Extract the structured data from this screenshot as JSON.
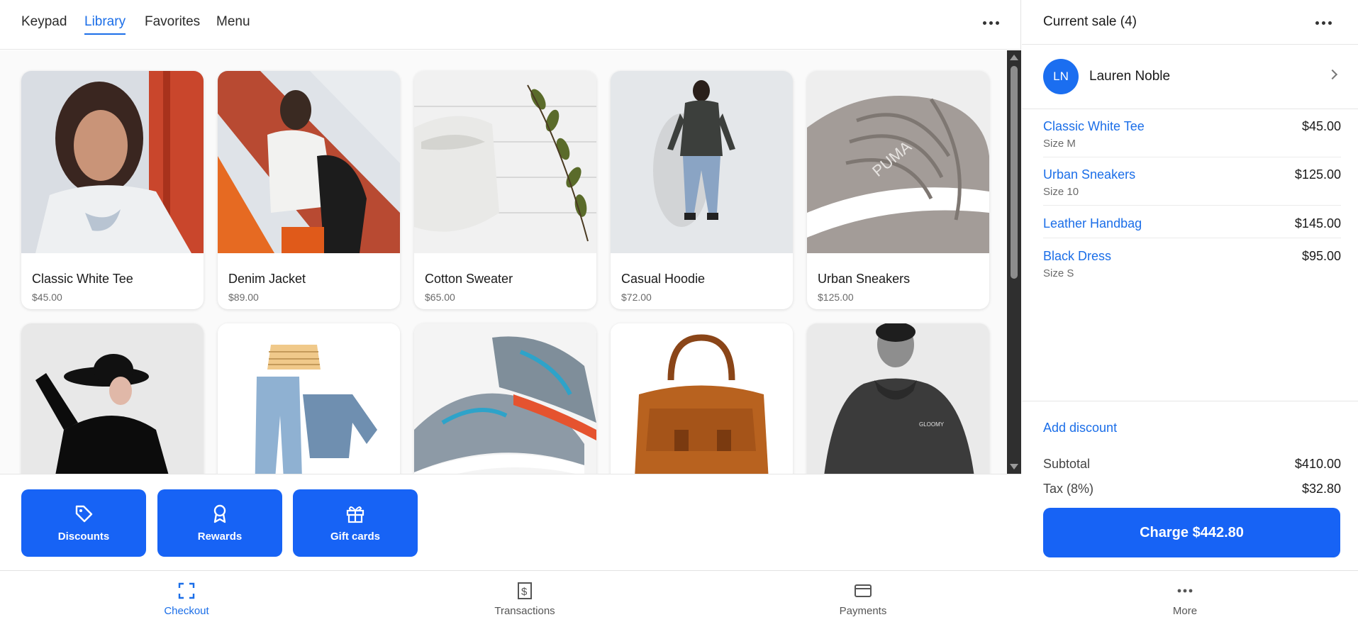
{
  "tabs": {
    "keypad": "Keypad",
    "library": "Library",
    "favorites": "Favorites",
    "menu": "Menu",
    "active": "Library"
  },
  "products": [
    {
      "name": "Classic White Tee",
      "price": "$45.00"
    },
    {
      "name": "Denim Jacket",
      "price": "$89.00"
    },
    {
      "name": "Cotton Sweater",
      "price": "$65.00"
    },
    {
      "name": "Casual Hoodie",
      "price": "$72.00"
    },
    {
      "name": "Urban Sneakers",
      "price": "$125.00"
    }
  ],
  "actions": {
    "discounts": "Discounts",
    "rewards": "Rewards",
    "gift_cards": "Gift cards"
  },
  "sale": {
    "title": "Current sale (4)",
    "customer": {
      "initials": "LN",
      "name": "Lauren Noble"
    },
    "items": [
      {
        "name": "Classic White Tee",
        "price": "$45.00",
        "variant": "Size M"
      },
      {
        "name": "Urban Sneakers",
        "price": "$125.00",
        "variant": "Size 10"
      },
      {
        "name": "Leather Handbag",
        "price": "$145.00",
        "variant": ""
      },
      {
        "name": "Black Dress",
        "price": "$95.00",
        "variant": "Size S"
      }
    ],
    "add_discount": "Add discount",
    "subtotal_label": "Subtotal",
    "subtotal": "$410.00",
    "tax_label": "Tax (8%)",
    "tax": "$32.80",
    "charge_label": "Charge $442.80"
  },
  "bottom_nav": {
    "checkout": "Checkout",
    "transactions": "Transactions",
    "payments": "Payments",
    "more": "More",
    "active": "Checkout"
  },
  "colors": {
    "accent": "#1b6ee8",
    "button": "#1763f5"
  }
}
